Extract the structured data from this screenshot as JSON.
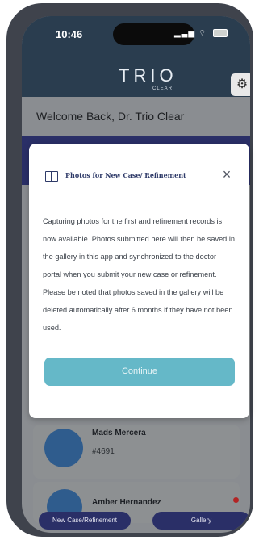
{
  "status_bar": {
    "time": "10:46",
    "signal_icon": "signal-icon",
    "wifi_icon": "wifi-icon",
    "battery_icon": "battery-icon"
  },
  "header": {
    "logo_text": "TRIO",
    "logo_subtitle": "CLEAR",
    "settings_icon": "gear-icon"
  },
  "welcome": {
    "text": "Welcome Back, Dr. Trio Clear"
  },
  "modal": {
    "title": "Photos for New Case/ Refinement",
    "title_icon": "book-icon",
    "close_icon": "close-icon",
    "body": "Capturing photos for the first and refinement records is now available. Photos submitted here will then be saved in the gallery in this app and synchronized to the doctor portal when you submit your new case or refinement. Please be noted that photos saved in the gallery will be deleted automatically after 6 months if they have not been used.",
    "continue_label": "Continue"
  },
  "patients": [
    {
      "name": "Mads Mercera",
      "case_id": "#4691"
    },
    {
      "name": "Amber Hernandez",
      "status_dot_color": "#b22424"
    }
  ],
  "bottom_nav": {
    "new_case_label": "New Case/Refinement",
    "gallery_label": "Gallery"
  }
}
